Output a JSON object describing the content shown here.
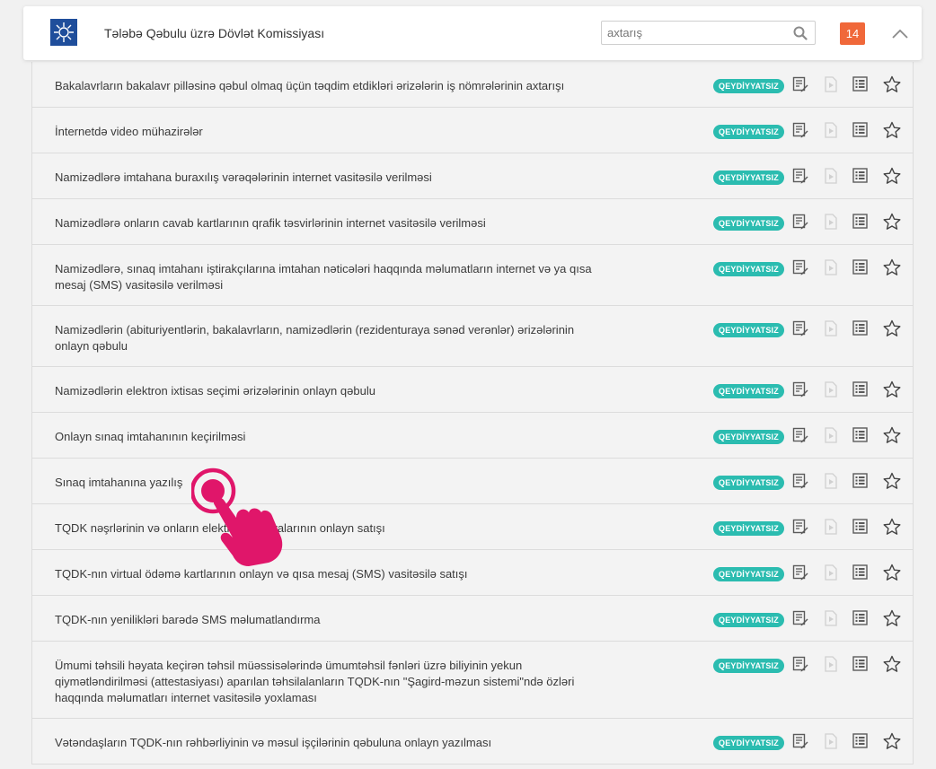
{
  "header": {
    "org_title": "Tələbə Qəbulu üzrə Dövlət Komissiyası",
    "search_placeholder": "axtarış",
    "count": "14",
    "logo_icon": "tqdk-logo-icon",
    "search_icon": "search-icon",
    "collapse_icon": "chevron-up-icon",
    "badge_color": "#f0683a"
  },
  "tag_color": "#2bbcb0",
  "services": [
    {
      "title": "Bakalavrların bakalavr pilləsinə qəbul olmaq üçün təqdim etdikləri ərizələrin iş nömrələrinin axtarışı",
      "tag": "QEYDİYYATSIZ"
    },
    {
      "title": "İnternetdə video mühazirələr",
      "tag": "QEYDİYYATSIZ"
    },
    {
      "title": "Namizədlərə imtahana buraxılış vərəqələrinin internet vasitəsilə verilməsi",
      "tag": "QEYDİYYATSIZ"
    },
    {
      "title": "Namizədlərə onların cavab kartlarının qrafik təsvirlərinin internet vasitəsilə verilməsi",
      "tag": "QEYDİYYATSIZ"
    },
    {
      "title": "Namizədlərə, sınaq imtahanı iştirakçılarına imtahan nəticələri haqqında məlumatların internet və ya qısa mesaj (SMS) vasitəsilə verilməsi",
      "tag": "QEYDİYYATSIZ"
    },
    {
      "title": "Namizədlərin (abituriyentlərin, bakalavrların, namizədlərin (rezidenturaya sənəd verənlər) ərizələrinin onlayn qəbulu",
      "tag": "QEYDİYYATSIZ"
    },
    {
      "title": "Namizədlərin elektron ixtisas seçimi ərizələrinin onlayn qəbulu",
      "tag": "QEYDİYYATSIZ"
    },
    {
      "title": "Onlayn sınaq imtahanının keçirilməsi",
      "tag": "QEYDİYYATSIZ"
    },
    {
      "title": "Sınaq imtahanına yazılış",
      "tag": "QEYDİYYATSIZ"
    },
    {
      "title": "TQDK nəşrlərinin və onların elektron versiyalarının onlayn satışı",
      "tag": "QEYDİYYATSIZ"
    },
    {
      "title": "TQDK-nın virtual ödəmə kartlarının onlayn və qısa mesaj (SMS) vasitəsilə satışı",
      "tag": "QEYDİYYATSIZ"
    },
    {
      "title": "TQDK-nın yenilikləri barədə SMS məlumatlandırma",
      "tag": "QEYDİYYATSIZ"
    },
    {
      "title": "Ümumi təhsili həyata keçirən təhsil müəssisələrində ümumtəhsil fənləri üzrə biliyinin yekun qiymətləndirilməsi (attestasiyası) aparılan təhsilalanların TQDK-nın \"Şagird-məzun sistemi\"ndə özləri haqqında məlumatları internet vasitəsilə yoxlaması",
      "tag": "QEYDİYYATSIZ"
    },
    {
      "title": "Vətəndaşların TQDK-nın rəhbərliyinin və məsul işçilərinin qəbuluna onlayn yazılması",
      "tag": "QEYDİYYATSIZ"
    }
  ],
  "row_icons": [
    "apply-form-icon",
    "video-play-icon",
    "details-list-icon",
    "favorite-star-icon"
  ],
  "overlay": {
    "icon": "tap-hand-pointer-icon",
    "color": "#e0166a"
  }
}
